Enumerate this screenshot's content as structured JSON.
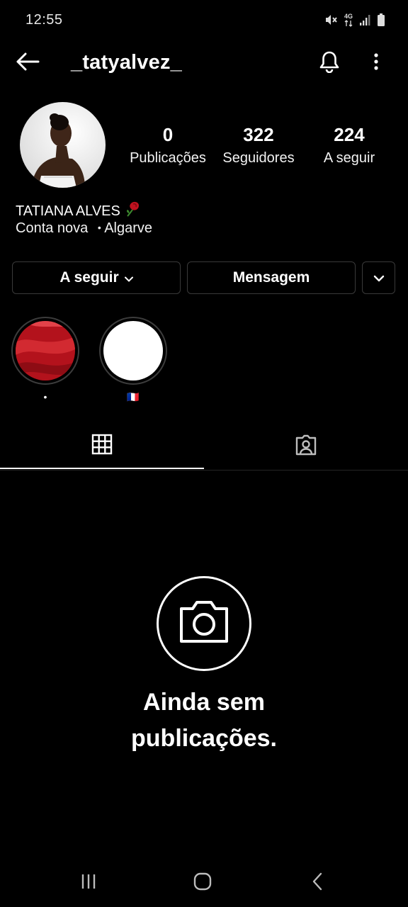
{
  "status_bar": {
    "time": "12:55",
    "network_label": "4G",
    "icons": [
      "mute-vibrate-icon",
      "4g-data-icon",
      "signal-icon",
      "battery-icon"
    ]
  },
  "header": {
    "username": "_tatyalvez_",
    "icons": [
      "back-arrow-icon",
      "bell-icon",
      "more-vertical-icon"
    ]
  },
  "profile": {
    "stats": [
      {
        "value": "0",
        "label": "Publicações"
      },
      {
        "value": "322",
        "label": "Seguidores"
      },
      {
        "value": "224",
        "label": "A seguir"
      }
    ],
    "full_name": "TATIANA ALVES",
    "name_emoji": "rose-icon",
    "bio_account": "Conta nova",
    "bio_separator": "•",
    "bio_location": "Algarve"
  },
  "actions": {
    "follow_label": "A seguir",
    "message_label": "Mensagem"
  },
  "highlights": [
    {
      "label": "•",
      "cover": "red-fabric"
    },
    {
      "label": "🇫🇷",
      "cover": "white"
    }
  ],
  "tabs": [
    {
      "name": "grid",
      "icon": "grid-icon",
      "active": true
    },
    {
      "name": "tagged",
      "icon": "tagged-person-icon",
      "active": false
    }
  ],
  "empty_state": {
    "line1": "Ainda sem",
    "line2": "publicações.",
    "icon": "camera-icon"
  },
  "colors": {
    "background": "#000000",
    "text": "#ffffff",
    "border": "#3a3a3a",
    "divider": "#262626"
  }
}
